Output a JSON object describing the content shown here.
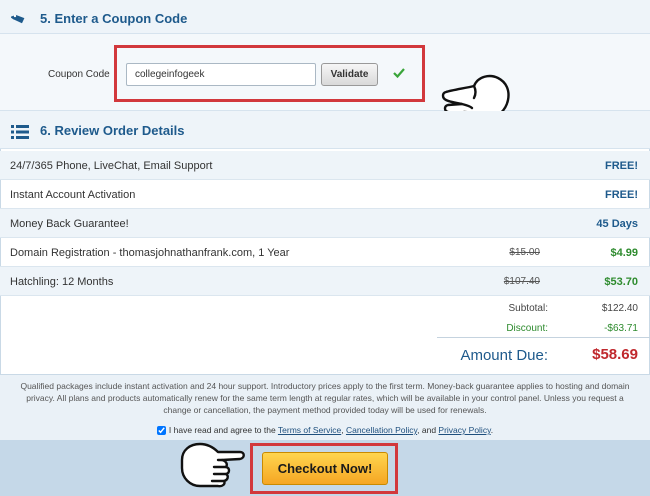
{
  "coupon_section": {
    "title": "5. Enter a Coupon Code",
    "label": "Coupon Code",
    "input_value": "collegeinfogeek",
    "validate_label": "Validate"
  },
  "review_section": {
    "title": "6. Review Order Details",
    "rows": [
      {
        "desc": "24/7/365 Phone, LiveChat, Email Support",
        "old": "",
        "price": "FREE!"
      },
      {
        "desc": "Instant Account Activation",
        "old": "",
        "price": "FREE!"
      },
      {
        "desc": "Money Back Guarantee!",
        "old": "",
        "price": "45 Days"
      },
      {
        "desc": "Domain Registration - thomasjohnathanfrank.com, 1 Year",
        "old": "$15.00",
        "price": "$4.99"
      },
      {
        "desc": "Hatchling: 12 Months",
        "old": "$107.40",
        "price": "$53.70"
      }
    ]
  },
  "totals": {
    "subtotal_label": "Subtotal:",
    "subtotal_value": "$122.40",
    "discount_label": "Discount:",
    "discount_value": "-$63.71",
    "amount_label": "Amount Due:",
    "amount_value": "$58.69"
  },
  "footer": {
    "fine_print": "Qualified packages include instant activation and 24 hour support. Introductory prices apply to the first term. Money-back guarantee applies to hosting and domain privacy. All plans and products automatically renew for the same term length at regular rates, which will be available in your control panel. Unless you request a change or cancellation, the payment method provided today will be used for renewals.",
    "agree_text": "I have read and agree to the ",
    "tos": "Terms of Service",
    "sep1": ", ",
    "cancellation": "Cancellation Policy",
    "sep2": ", and ",
    "privacy": "Privacy Policy",
    "end": ".",
    "checkout_label": "Checkout Now!"
  },
  "icons": [
    "tag-icon",
    "list-icon",
    "checkmark-icon",
    "pointing-hand-icon"
  ],
  "colors": {
    "heading": "#1e5a8c",
    "highlight": "#d2383c",
    "green": "#2e8b2e",
    "amount": "#c0282d",
    "button": "#f5a623"
  }
}
